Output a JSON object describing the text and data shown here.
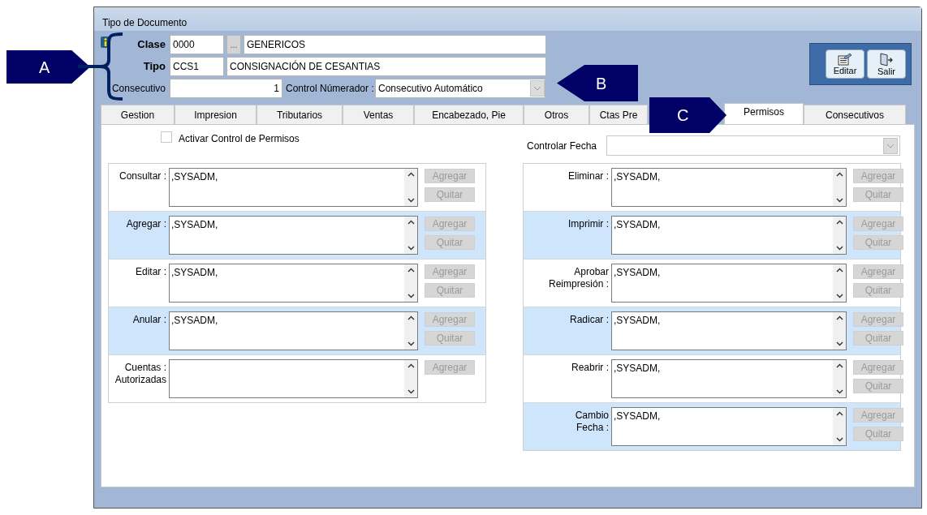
{
  "window": {
    "title": "Tipo de Documento"
  },
  "header": {
    "clase": {
      "label": "Clase",
      "code": "0000",
      "browse": "...",
      "name": "GENERICOS"
    },
    "tipo": {
      "label": "Tipo",
      "code": "CCS1",
      "name": "CONSIGNACIÓN DE CESANTIAS"
    },
    "consecutivo": {
      "label": "Consecutivo",
      "value": "1"
    },
    "control_numerador": {
      "label": "Control Númerador :",
      "value": "Consecutivo Automático"
    }
  },
  "toolbar": [
    {
      "label": "Editar",
      "kind": "edit"
    },
    {
      "label": "Salir",
      "kind": "exit"
    }
  ],
  "tabs": [
    {
      "label": "Gestion",
      "selected": false
    },
    {
      "label": "Impresion",
      "selected": false
    },
    {
      "label": "Tributarios",
      "selected": false
    },
    {
      "label": "Ventas",
      "selected": false
    },
    {
      "label": "Encabezado, Pie",
      "selected": false
    },
    {
      "label": "Otros",
      "selected": false
    },
    {
      "label": "Ctas Pre",
      "selected": false
    },
    {
      "label": "Permisos",
      "selected": true
    },
    {
      "label": "Consecutivos",
      "selected": false
    }
  ],
  "activar_control": {
    "label": "Activar Control de Permisos",
    "checked": false
  },
  "controlar_fecha": {
    "label": "Controlar Fecha"
  },
  "permissions_left": [
    {
      "label": "Consultar :",
      "value": ",SYSADM,",
      "buttons": [
        {
          "label": "Agregar",
          "disabled": true
        },
        {
          "label": "Quitar",
          "disabled": true
        }
      ]
    },
    {
      "label": "Agregar :",
      "value": ",SYSADM,",
      "buttons": [
        {
          "label": "Agregar",
          "disabled": true
        },
        {
          "label": "Quitar",
          "disabled": true
        }
      ]
    },
    {
      "label": "Editar :",
      "value": ",SYSADM,",
      "buttons": [
        {
          "label": "Agregar",
          "disabled": true
        },
        {
          "label": "Quitar",
          "disabled": true
        }
      ]
    },
    {
      "label": "Anular :",
      "value": ",SYSADM,",
      "buttons": [
        {
          "label": "Agregar",
          "disabled": true
        },
        {
          "label": "Quitar",
          "disabled": true
        }
      ]
    },
    {
      "label": "Cuentas :\nAutorizadas",
      "buttons": [
        {
          "label": "Agregar",
          "disabled": true
        }
      ]
    }
  ],
  "permissions_right": [
    {
      "label": "Eliminar :",
      "value": ",SYSADM,",
      "buttons": [
        {
          "label": "Agregar",
          "disabled": true
        },
        {
          "label": "Quitar",
          "disabled": true
        }
      ]
    },
    {
      "label": "Imprimir :",
      "value": ",SYSADM,",
      "buttons": [
        {
          "label": "Agregar",
          "disabled": true
        },
        {
          "label": "Quitar",
          "disabled": true
        }
      ]
    },
    {
      "label": "Aprobar\nReimpresión :",
      "value": ",SYSADM,",
      "buttons": [
        {
          "label": "Agregar",
          "disabled": true
        },
        {
          "label": "Quitar",
          "disabled": true
        }
      ]
    },
    {
      "label": "Radicar :",
      "value": ",SYSADM,",
      "buttons": [
        {
          "label": "Agregar",
          "disabled": true
        },
        {
          "label": "Quitar",
          "disabled": true
        }
      ]
    },
    {
      "label": "Reabrir :",
      "value": ",SYSADM,",
      "buttons": [
        {
          "label": "Agregar",
          "disabled": true
        },
        {
          "label": "Quitar",
          "disabled": true
        }
      ]
    },
    {
      "label": "Cambio\nFecha :",
      "value": ",SYSADM,",
      "buttons": [
        {
          "label": "Agregar",
          "disabled": true
        },
        {
          "label": "Quitar",
          "disabled": true
        }
      ]
    }
  ],
  "callouts": [
    {
      "label": "A",
      "kind": "bracket"
    },
    {
      "label": "B",
      "kind": "left"
    },
    {
      "label": "C",
      "kind": "right"
    }
  ]
}
